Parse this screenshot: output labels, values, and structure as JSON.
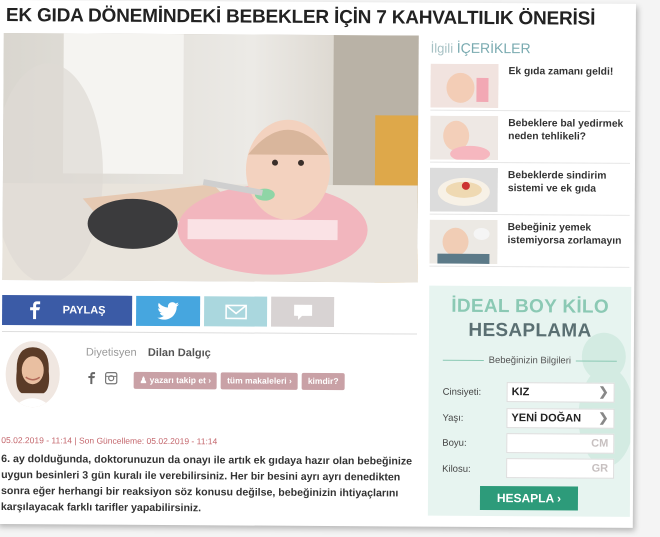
{
  "article": {
    "title": "EK GIDA DÖNEMİNDEKİ BEBEKLER İÇİN 7 KAHVALTILIK ÖNERİSİ",
    "date": "05.02.2019 - 11:14 | Son Güncelleme: 05.02.2019 - 11:14",
    "body": "6. ay dolduğunda, doktorunuzun da onayı ile artık ek gıdaya hazır olan bebeğinize uygun besinleri 3 gün kuralı ile verebilirsiniz. Her bir besini ayrı ayrı denedikten sonra eğer herhangi bir reaksiyon söz konusu değilse, bebeğinizin ihtiyaçlarını karşılayacak farklı tarifler yapabilirsiniz."
  },
  "share": {
    "facebook_label": "PAYLAŞ"
  },
  "author": {
    "role": "Diyetisyen",
    "name": "Dilan Dalgıç",
    "follow_label": "yazarı takip et ›",
    "articles_label": "tüm makaleleri ›",
    "who_label": "kimdir?"
  },
  "related": {
    "heading_prefix": "İlgili",
    "heading_main": "İÇERİKLER",
    "items": [
      {
        "title": "Ek gıda zamanı geldi!"
      },
      {
        "title": "Bebeklere bal yedirmek neden tehlikeli?"
      },
      {
        "title": "Bebeklerde sindirim sistemi ve ek gıda"
      },
      {
        "title": "Bebeğiniz yemek istemiyorsa zorlamayın"
      }
    ]
  },
  "calculator": {
    "title1": "İDEAL BOY KİLO",
    "title2": "HESAPLAMA",
    "subtitle": "Bebeğinizin Bilgileri",
    "gender_label": "Cinsiyeti:",
    "gender_value": "KIZ",
    "age_label": "Yaşı:",
    "age_value": "YENİ DOĞAN",
    "height_label": "Boyu:",
    "height_unit": "CM",
    "weight_label": "Kilosu:",
    "weight_unit": "GR",
    "button_label": "HESAPLA ›"
  },
  "colors": {
    "facebook": "#3b5ba6",
    "twitter": "#46a6df",
    "mail": "#aad7de",
    "comment": "#d8d3d3",
    "tag": "#c9a1a6",
    "calc_bg": "#e7f4f0",
    "calc_button": "#2d9b7a"
  }
}
